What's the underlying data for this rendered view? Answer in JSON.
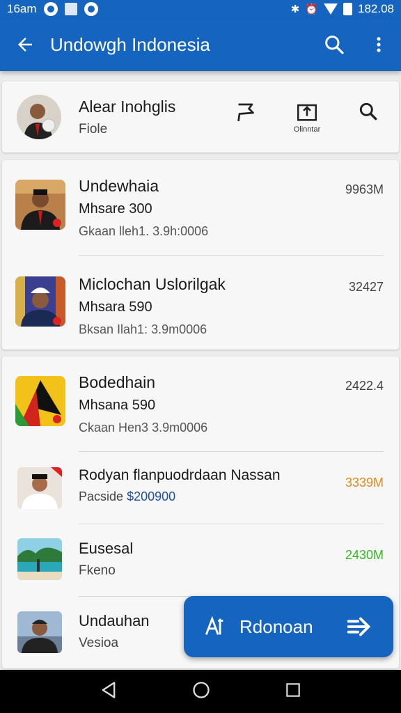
{
  "status_bar": {
    "time": "16am",
    "clock": "182.08"
  },
  "app_bar": {
    "title": "Undowgh Indonesia",
    "back_icon": "arrow-back-icon",
    "search_icon": "search-icon",
    "more_icon": "more-vert-icon"
  },
  "profile": {
    "name": "Alear Inohglis",
    "subtitle": "Fiole",
    "action_label": "Olinntar"
  },
  "list_card_1": [
    {
      "title": "Undewhaia",
      "line2": "Mhsare 300",
      "line3": "Gkaan lleh1. 3.9h:0006",
      "value": "9963M"
    },
    {
      "title": "Miclochan Uslorilgak",
      "line2": "Mhsara 590",
      "line3": "Bksan Ilah1: 3.9m0006",
      "value": "32427"
    }
  ],
  "list_card_2": [
    {
      "title": "Bodedhain",
      "line2": "Mhsana 590",
      "line3": "Ckaan Hen3 3.9m0006",
      "value": "2422.4"
    },
    {
      "title": "Rodyan flanpuodrdaan Nassan",
      "line2_prefix": "Pacside",
      "line2_price": "$200900",
      "value": "3339M",
      "value_color": "#e08a1e"
    },
    {
      "title": "Eusesal",
      "line2": "Fkeno",
      "value": "2430M",
      "value_color": "#34b820"
    },
    {
      "title": "Undauhan",
      "line2": "Vesioa"
    }
  ],
  "fab": {
    "label": "Rdonoan"
  }
}
